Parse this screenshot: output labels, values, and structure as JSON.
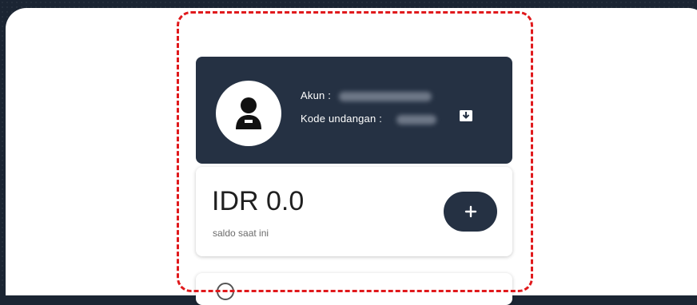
{
  "profile": {
    "account_label": "Akun :",
    "invite_code_label": "Kode undangan :",
    "avatar_icon": "user-icon",
    "copy_icon": "copy-icon"
  },
  "balance": {
    "amount": "IDR 0.0",
    "caption": "saldo saat ini",
    "add_button_label": "+"
  },
  "colors": {
    "card_dark": "#253143",
    "highlight": "#e0191c",
    "background": "#1b2533"
  }
}
